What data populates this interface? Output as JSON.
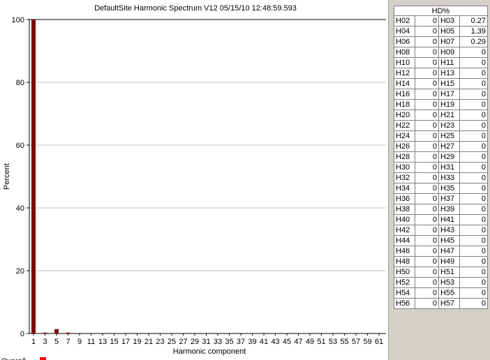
{
  "chart_data": {
    "type": "bar",
    "title": "DefaultSite  Harmonic Spectrum V12  05/15/10  12:48:59.593",
    "xlabel": "Harmonic component",
    "ylabel": "Percent",
    "ylim": [
      0,
      100
    ],
    "yticks": [
      "0",
      "20",
      "40",
      "60",
      "80",
      "100"
    ],
    "grid": true,
    "bar_color": "#800000",
    "xtick_labels": [
      "1",
      "3",
      "5",
      "7",
      "9",
      "11",
      "13",
      "15",
      "17",
      "19",
      "21",
      "23",
      "25",
      "27",
      "29",
      "31",
      "33",
      "35",
      "37",
      "39",
      "41",
      "43",
      "45",
      "47",
      "49",
      "51",
      "53",
      "55",
      "57",
      "59",
      "61"
    ],
    "harmonics": [
      1,
      2,
      3,
      4,
      5,
      6,
      7,
      8,
      9,
      10,
      11,
      12,
      13,
      14,
      15,
      16,
      17,
      18,
      19,
      20,
      21,
      22,
      23,
      24,
      25,
      26,
      27,
      28,
      29,
      30,
      31,
      32,
      33,
      34,
      35,
      36,
      37,
      38,
      39,
      40,
      41,
      42,
      43,
      44,
      45,
      46,
      47,
      48,
      49,
      50,
      51,
      52,
      53,
      54,
      55,
      56,
      57,
      58,
      59,
      60,
      61
    ],
    "values": [
      100,
      0,
      0.27,
      0,
      1.39,
      0,
      0.29,
      0,
      0,
      0,
      0,
      0,
      0,
      0,
      0,
      0,
      0,
      0,
      0,
      0,
      0,
      0,
      0,
      0,
      0,
      0,
      0,
      0,
      0,
      0,
      0,
      0,
      0,
      0,
      0,
      0,
      0,
      0,
      0,
      0,
      0,
      0,
      0,
      0,
      0,
      0,
      0,
      0,
      0,
      0,
      0,
      0,
      0,
      0,
      0,
      0,
      0,
      0,
      0,
      0,
      0
    ],
    "legend": [
      {
        "name": "Overall",
        "color": "#ff0000"
      }
    ]
  },
  "table": {
    "header": "HD%",
    "rows": [
      [
        "H02",
        "0",
        "H03",
        "0.27"
      ],
      [
        "H04",
        "0",
        "H05",
        "1.39"
      ],
      [
        "H06",
        "0",
        "H07",
        "0.29"
      ],
      [
        "H08",
        "0",
        "H09",
        "0"
      ],
      [
        "H10",
        "0",
        "H11",
        "0"
      ],
      [
        "H12",
        "0",
        "H13",
        "0"
      ],
      [
        "H14",
        "0",
        "H15",
        "0"
      ],
      [
        "H16",
        "0",
        "H17",
        "0"
      ],
      [
        "H18",
        "0",
        "H19",
        "0"
      ],
      [
        "H20",
        "0",
        "H21",
        "0"
      ],
      [
        "H22",
        "0",
        "H23",
        "0"
      ],
      [
        "H24",
        "0",
        "H25",
        "0"
      ],
      [
        "H26",
        "0",
        "H27",
        "0"
      ],
      [
        "H28",
        "0",
        "H29",
        "0"
      ],
      [
        "H30",
        "0",
        "H31",
        "0"
      ],
      [
        "H32",
        "0",
        "H33",
        "0"
      ],
      [
        "H34",
        "0",
        "H35",
        "0"
      ],
      [
        "H36",
        "0",
        "H37",
        "0"
      ],
      [
        "H38",
        "0",
        "H39",
        "0"
      ],
      [
        "H40",
        "0",
        "H41",
        "0"
      ],
      [
        "H42",
        "0",
        "H43",
        "0"
      ],
      [
        "H44",
        "0",
        "H45",
        "0"
      ],
      [
        "H46",
        "0",
        "H47",
        "0"
      ],
      [
        "H48",
        "0",
        "H49",
        "0"
      ],
      [
        "H50",
        "0",
        "H51",
        "0"
      ],
      [
        "H52",
        "0",
        "H53",
        "0"
      ],
      [
        "H54",
        "0",
        "H55",
        "0"
      ],
      [
        "H56",
        "0",
        "H57",
        "0"
      ]
    ]
  }
}
